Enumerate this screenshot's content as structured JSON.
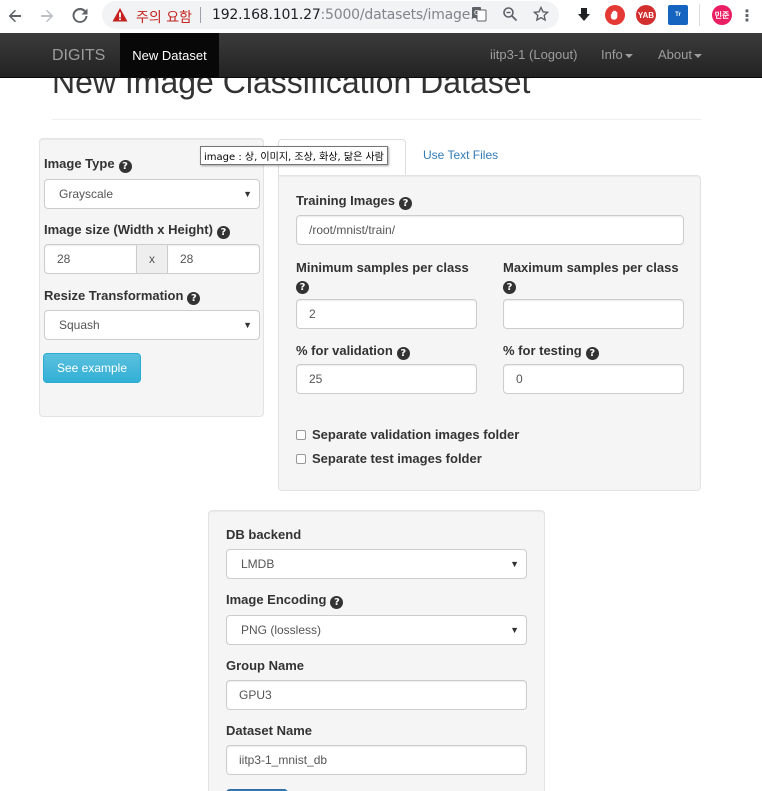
{
  "browser": {
    "warning_text": "주의 요함",
    "url_host": "192.168.101.27",
    "url_rest": ":5000/datasets/image..."
  },
  "navbar": {
    "brand": "DIGITS",
    "active_tab": "New Dataset",
    "user_link": "iitp3-1 (Logout)",
    "info_menu": "Info",
    "about_menu": "About"
  },
  "page": {
    "title": "New Image Classification Dataset"
  },
  "left_panel": {
    "image_type_label": "Image Type",
    "image_type_value": "Grayscale",
    "image_size_label": "Image size (Width x Height)",
    "width_value": "28",
    "size_separator": "x",
    "height_value": "28",
    "resize_label": "Resize Transformation",
    "resize_value": "Squash",
    "see_example_label": "See example"
  },
  "tooltip": {
    "text": "image : 상, 이미지, 조상, 화상, 닮은 사람"
  },
  "tabs": {
    "text_files_tab": "Use Text Files"
  },
  "main_panel": {
    "training_images_label": "Training Images",
    "training_images_value": "/root/mnist/train/",
    "min_samples_label": "Minimum samples per class",
    "min_samples_value": "2",
    "max_samples_label": "Maximum samples per class",
    "max_samples_value": "",
    "validation_label": "% for validation",
    "validation_value": "25",
    "testing_label": "% for testing",
    "testing_value": "0",
    "separate_validation_label": "Separate validation images folder",
    "separate_test_label": "Separate test images folder"
  },
  "db_panel": {
    "db_backend_label": "DB backend",
    "db_backend_value": "LMDB",
    "encoding_label": "Image Encoding",
    "encoding_value": "PNG (lossless)",
    "group_label": "Group Name",
    "group_value": "GPU3",
    "dataset_name_label": "Dataset Name",
    "dataset_name_value": "iitp3-1_mnist_db"
  },
  "icons": {
    "help": "question-circle-icon",
    "select_arrow": "caret-down-icon",
    "back": "arrow-left-icon",
    "forward": "arrow-right-icon",
    "reload": "reload-icon",
    "warning": "warning-triangle-icon",
    "translate": "translate-icon",
    "zoom": "zoom-icon",
    "star": "star-icon"
  },
  "colors": {
    "navbar": "#222222",
    "warning": "#c5221f",
    "link": "#337ab7",
    "info_button": "#5bc0de"
  }
}
